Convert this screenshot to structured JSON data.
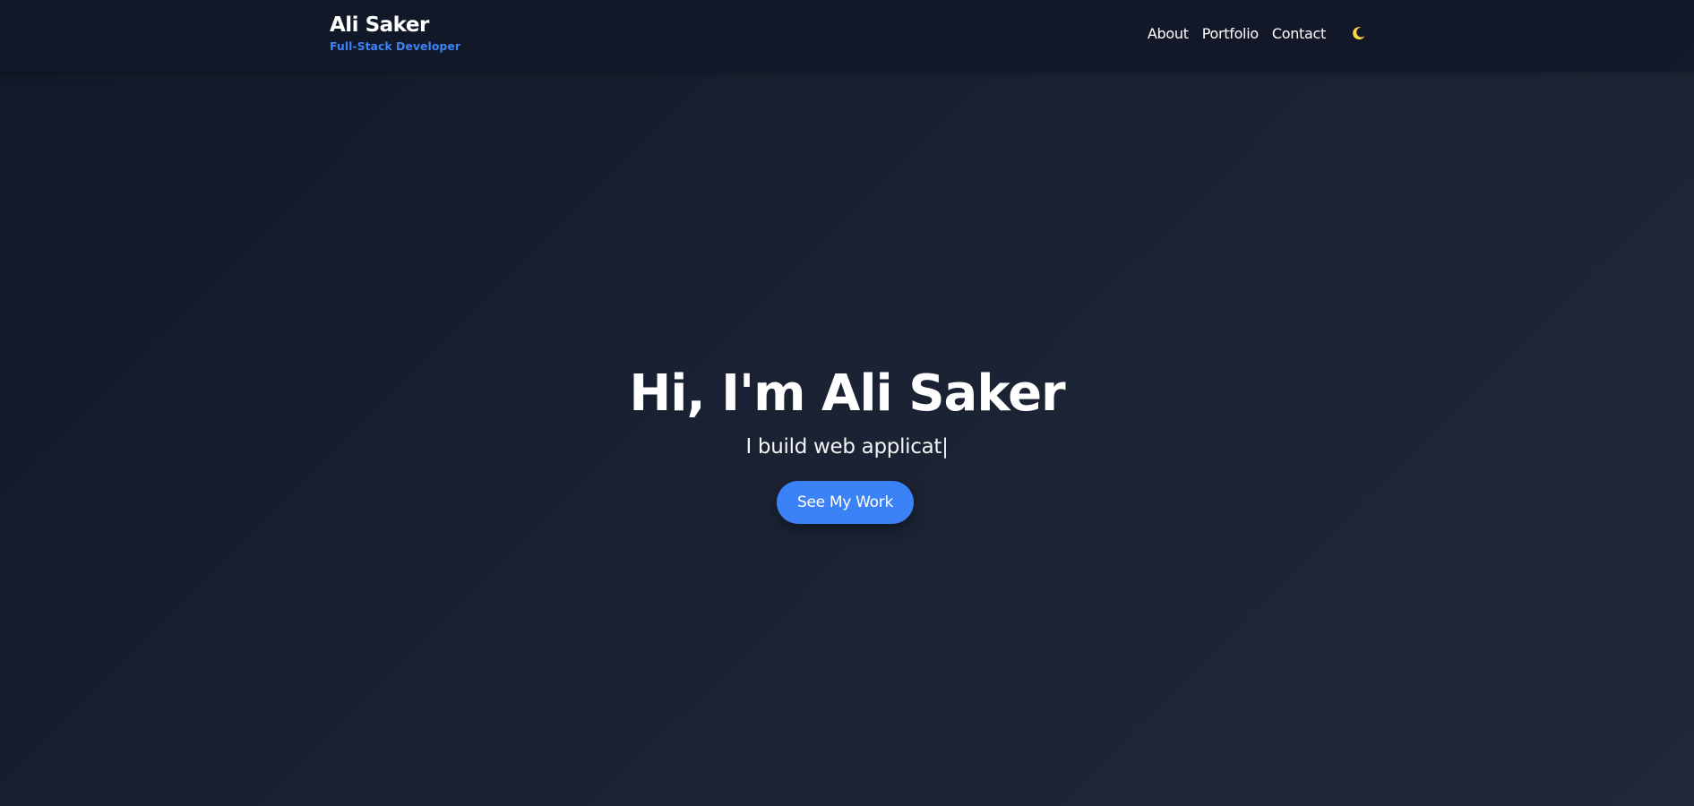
{
  "header": {
    "brand_name": "Ali Saker",
    "brand_role": "Full-Stack Developer",
    "nav": [
      {
        "label": "About"
      },
      {
        "label": "Portfolio"
      },
      {
        "label": "Contact"
      }
    ],
    "theme_toggle_icon": "moon-icon"
  },
  "hero": {
    "title": "Hi, I'm Ali Saker",
    "subtitle": "I build web applicat|",
    "cta_label": "See My Work"
  },
  "colors": {
    "background": "#111827",
    "accent": "#3b82f6",
    "moon": "#fcd34d"
  }
}
